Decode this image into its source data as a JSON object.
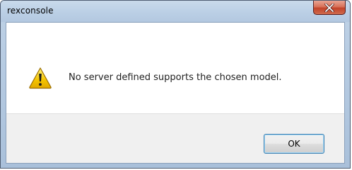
{
  "window": {
    "title": "rexconsole",
    "close_icon": "close-icon"
  },
  "message": {
    "icon": "warning-icon",
    "text": "No server defined supports the chosen model."
  },
  "buttons": {
    "ok_label": "OK"
  },
  "colors": {
    "close_button": "#c7492f",
    "warning_yellow": "#f5c400",
    "button_border_focus": "#3c7fb1",
    "button_area_bg": "#f0f0f0"
  }
}
